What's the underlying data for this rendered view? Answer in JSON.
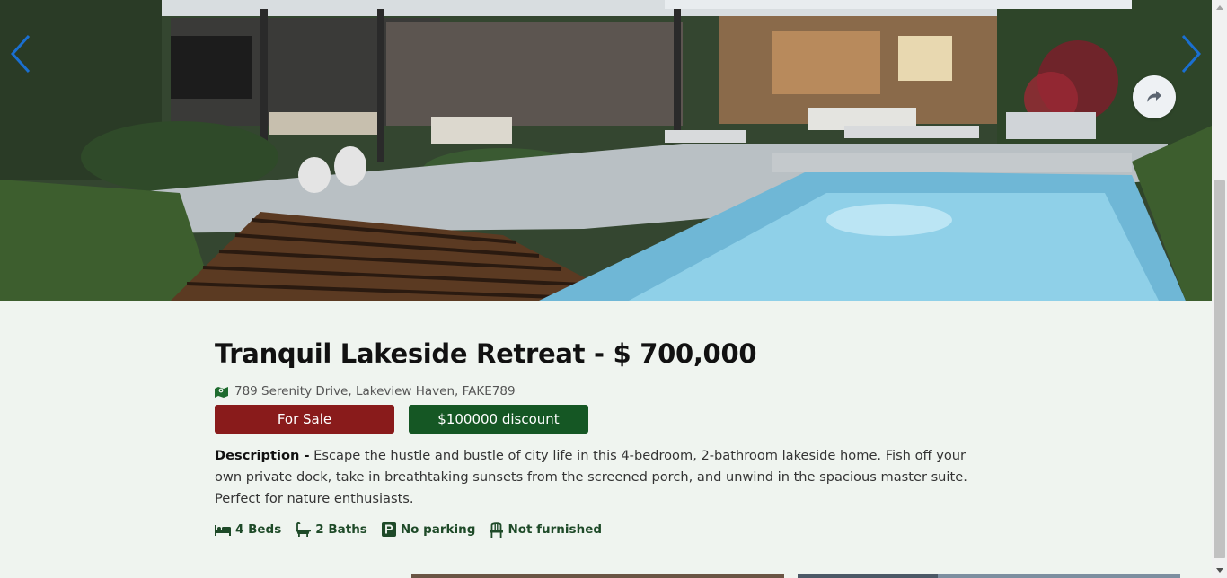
{
  "carousel": {
    "prev_icon": "chevron-left-icon",
    "next_icon": "chevron-right-icon",
    "share_icon": "share-icon",
    "accent_color": "#1a6fd1"
  },
  "listing": {
    "title": "Tranquil Lakeside Retreat - $ 700,000",
    "address": "789 Serenity Drive, Lakeview Haven, FAKE789",
    "status_badge": "For Sale",
    "discount_badge": "$100000 discount",
    "description_label": "Description -",
    "description_text": "Escape the hustle and bustle of city life in this 4-bedroom, 2-bathroom lakeside home. Fish off your own private dock, take in breathtaking sunsets from the screened porch, and unwind in the spacious master suite. Perfect for nature enthusiasts.",
    "features": [
      {
        "icon": "bed-icon",
        "label": "4 Beds"
      },
      {
        "icon": "bath-icon",
        "label": "2 Baths"
      },
      {
        "icon": "parking-icon",
        "label": "No parking"
      },
      {
        "icon": "chair-icon",
        "label": "Not furnished"
      }
    ]
  },
  "colors": {
    "sale": "#891b1b",
    "discount": "#155724",
    "feature_text": "#1e4a28",
    "background": "#eff4ef"
  }
}
